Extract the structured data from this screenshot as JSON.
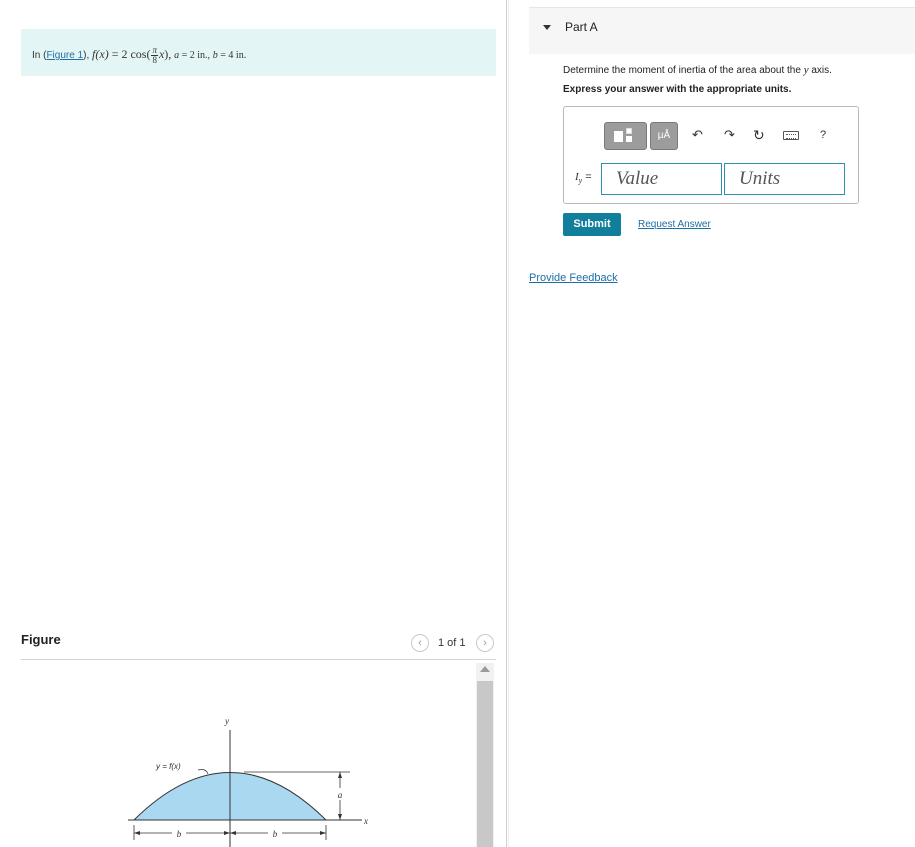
{
  "problem": {
    "prefix": "In (",
    "figure_link": "Figure 1",
    "suffix_link": "),",
    "f_lhs": "f(x)",
    "f_eq": " = 2 cos(",
    "frac_num": "π",
    "frac_den": "8",
    "f_x": "x",
    "f_close": "),",
    "a_label": "a",
    "a_value": " = 2 in.,",
    "b_label": "b",
    "b_value": " = 4 in."
  },
  "figure_panel": {
    "title": "Figure",
    "page_counter": "1 of 1",
    "prev_icon": "chevron-left-icon",
    "next_icon": "chevron-right-icon",
    "labels": {
      "y_axis": "y",
      "x_axis": "x",
      "curve": "y = f(x)",
      "a_dim": "a",
      "b_left": "b",
      "b_right": "b"
    },
    "fill_color": "#a9d8f0"
  },
  "part": {
    "title": "Part A",
    "question_before": "Determine the moment of inertia of the area about the ",
    "question_var": "y",
    "question_after": " axis.",
    "instruction": "Express your answer with the appropriate units."
  },
  "toolbar": {
    "templates_icon": "templates-icon",
    "units_label": "μÅ",
    "undo_icon": "undo-icon",
    "redo_icon": "redo-icon",
    "reset_icon": "reset-icon",
    "keyboard_icon": "keyboard-icon",
    "help_label": "?"
  },
  "answer": {
    "var_symbol": "I",
    "var_sub": "y",
    "var_eq": " =",
    "value_placeholder": "Value",
    "units_placeholder": "Units"
  },
  "actions": {
    "submit_label": "Submit",
    "request_answer_label": "Request Answer",
    "feedback_label": "Provide Feedback"
  },
  "colors": {
    "accent": "#117f9b",
    "link": "#1d6fa5",
    "problem_bg": "#e4f5f5"
  }
}
